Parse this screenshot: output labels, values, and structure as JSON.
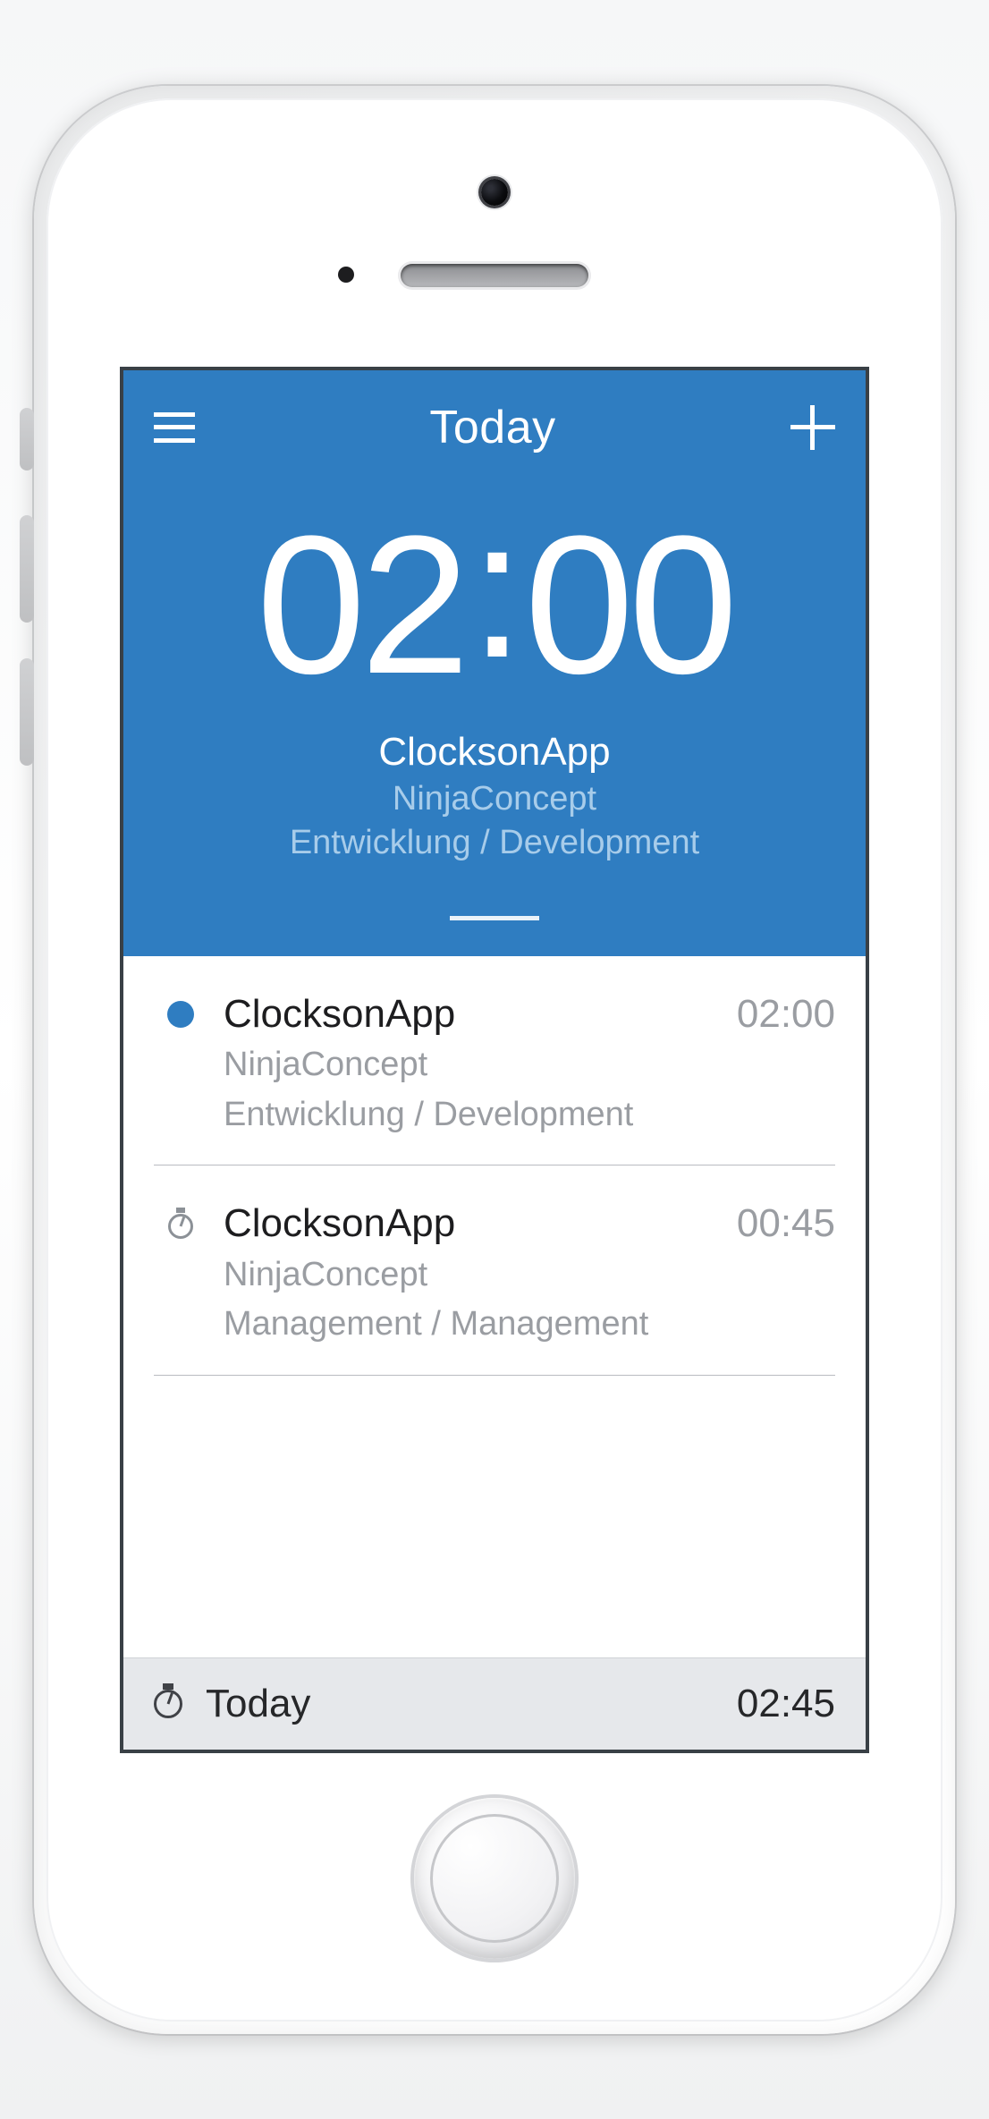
{
  "colors": {
    "accent": "#2f7dc1"
  },
  "navbar": {
    "title": "Today",
    "menu_icon": "menu-icon",
    "add_icon": "plus-icon"
  },
  "timer": {
    "time": "02:00",
    "hours": "02",
    "minutes": "00",
    "project": "ClocksonApp",
    "client": "NinjaConcept",
    "category": "Entwicklung / Development"
  },
  "entries": [
    {
      "status": "running",
      "title": "ClocksonApp",
      "client": "NinjaConcept",
      "category": "Entwicklung / Development",
      "duration": "02:00"
    },
    {
      "status": "idle",
      "title": "ClocksonApp",
      "client": "NinjaConcept",
      "category": "Management / Management",
      "duration": "00:45"
    }
  ],
  "footer": {
    "label": "Today",
    "total": "02:45"
  }
}
